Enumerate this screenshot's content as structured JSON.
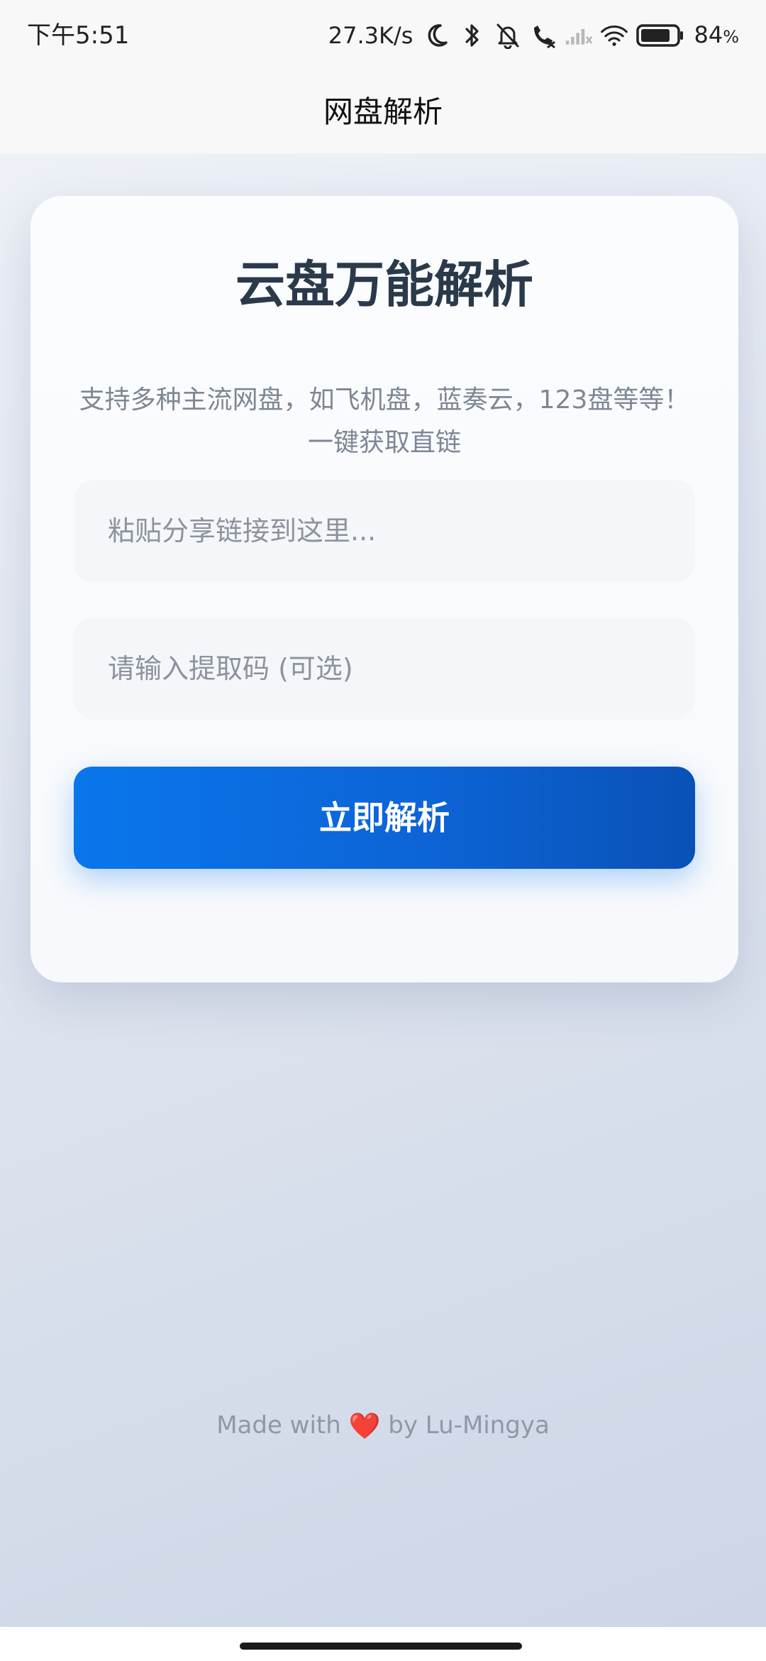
{
  "status_bar": {
    "time": "下午5:51",
    "network_speed": "27.3K/s",
    "battery_percent": "84",
    "battery_unit": "%",
    "battery_level": 0.84,
    "icons": [
      "moon-icon",
      "bluetooth-icon",
      "bell-off-icon",
      "call-icon",
      "signal-icon",
      "wifi-icon",
      "battery-icon"
    ]
  },
  "app_bar": {
    "title": "网盘解析"
  },
  "card": {
    "title": "云盘万能解析",
    "subtitle": "支持多种主流网盘，如飞机盘，蓝奏云，123盘等等！一键获取直链",
    "link_input": {
      "placeholder": "粘贴分享链接到这里...",
      "value": ""
    },
    "code_input": {
      "placeholder": "请输入提取码 (可选)",
      "value": ""
    },
    "submit_label": "立即解析"
  },
  "footer": {
    "prefix": "Made with",
    "heart": "❤️",
    "suffix": "by Lu-Mingya"
  },
  "colors": {
    "accent": "#0a76ec",
    "title_text": "#2b3a4a",
    "subtitle_text": "#7d8794",
    "heart": "#e5454a"
  }
}
